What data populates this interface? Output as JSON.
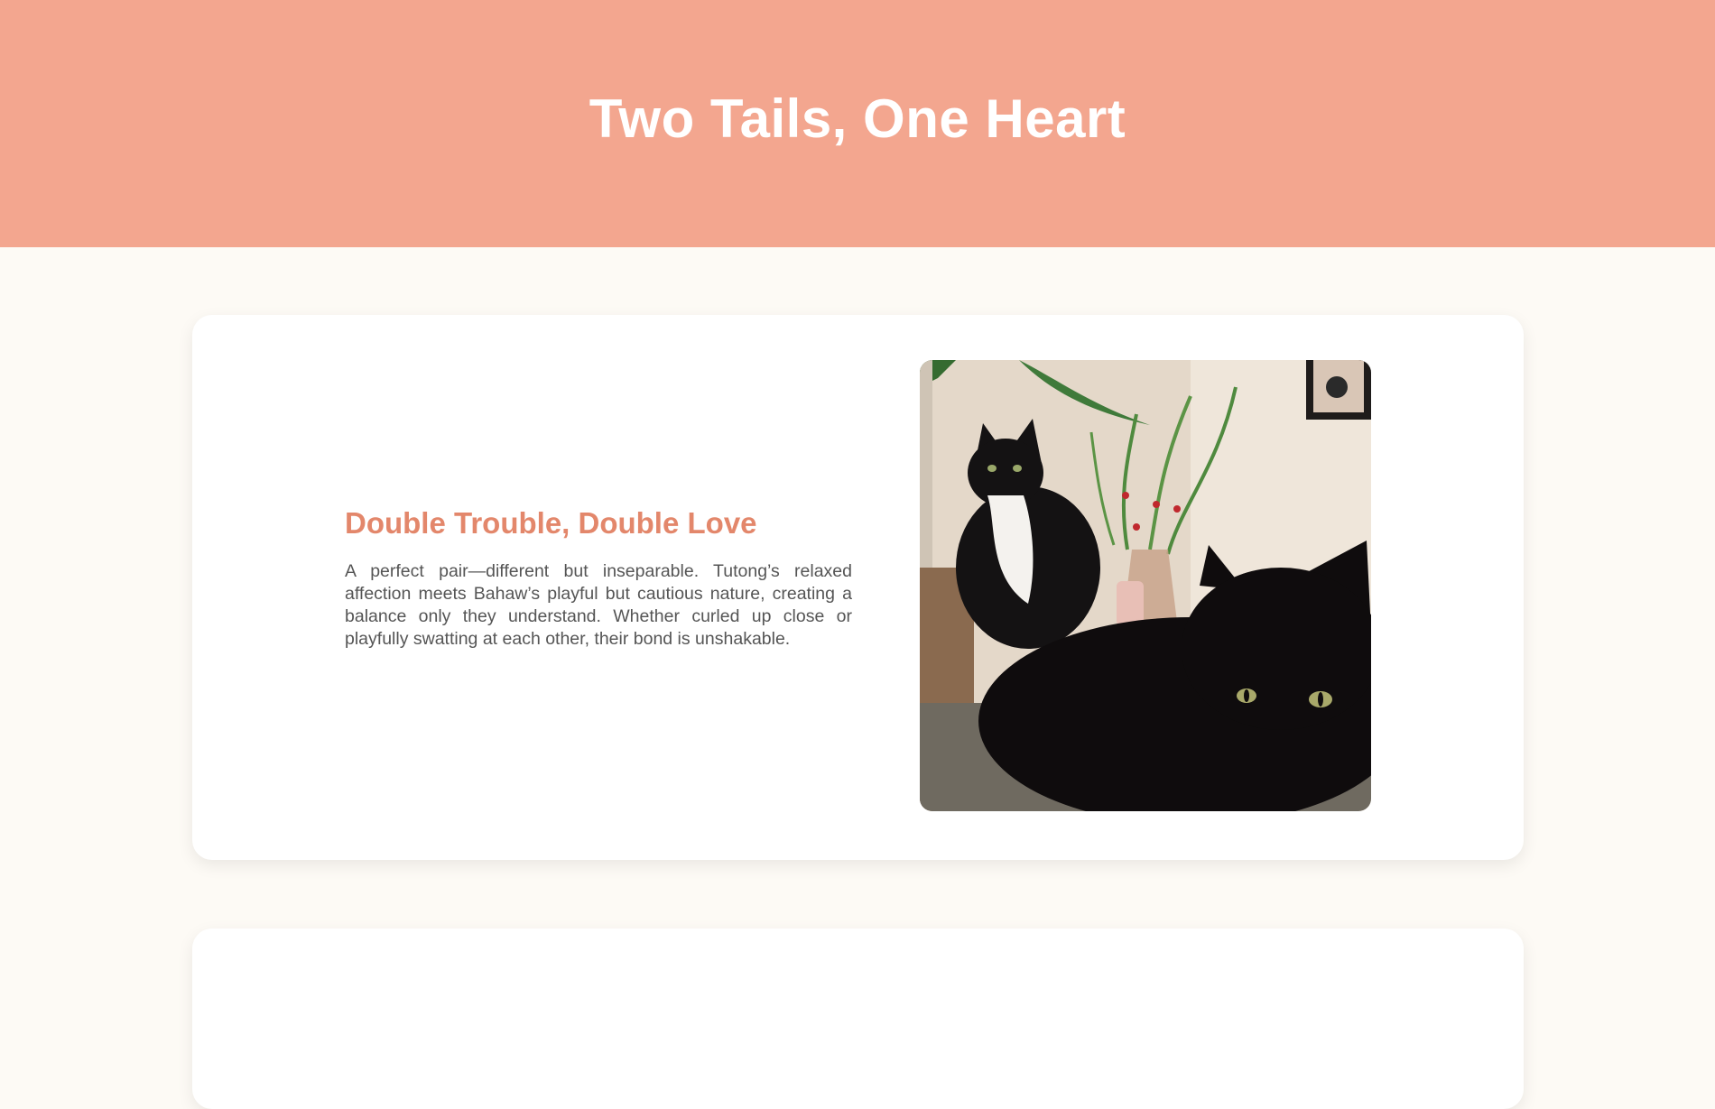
{
  "header": {
    "title": "Two Tails, One Heart",
    "background": "#f3a68f"
  },
  "cards": [
    {
      "heading": "Double Trouble, Double Love",
      "body": "A perfect pair—different but inseparable. Tutong’s relaxed affection meets Bahaw’s playful but cautious nature, creating a balance only they understand. Whether curled up close or playfully swatting at each other, their bond is unshakable.",
      "image_subject": "two-cats-photo"
    }
  ],
  "colors": {
    "accent": "#e3876b",
    "page_background": "#fdfaf5",
    "card_background": "#ffffff",
    "body_text": "#555555"
  }
}
